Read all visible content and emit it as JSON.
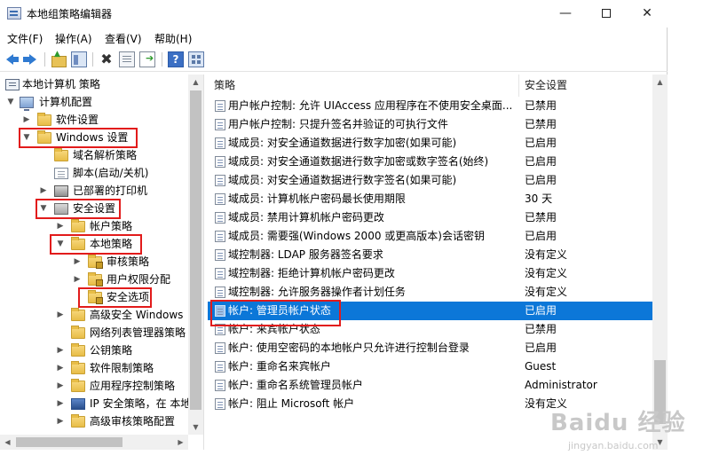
{
  "window": {
    "title": "本地组策略编辑器",
    "controls": {
      "minimize": "—",
      "maximize": "",
      "close": "✕"
    }
  },
  "menubar": [
    "文件(F)",
    "操作(A)",
    "查看(V)",
    "帮助(H)"
  ],
  "toolbar": {
    "icons": [
      "back-arrow-icon",
      "forward-arrow-icon",
      "up-folder-icon",
      "show-hide-tree-icon",
      "delete-icon",
      "properties-icon",
      "export-list-icon",
      "help-icon",
      "view-icon"
    ],
    "delete_glyph": "✖",
    "help_glyph": "?"
  },
  "tree": [
    {
      "label": "本地计算机 策略",
      "expander": "",
      "icon": "policy-icon",
      "highlight": false
    },
    {
      "label": "计算机配置",
      "expander": "▼",
      "icon": "computer-icon",
      "highlight": false
    },
    {
      "label": "软件设置",
      "expander": "▶",
      "icon": "folder-icon",
      "highlight": false
    },
    {
      "label": "Windows 设置",
      "expander": "▼",
      "icon": "folder-icon",
      "highlight": true
    },
    {
      "label": "域名解析策略",
      "expander": "",
      "icon": "folder-icon",
      "highlight": false
    },
    {
      "label": "脚本(启动/关机)",
      "expander": "",
      "icon": "script-icon",
      "highlight": false
    },
    {
      "label": "已部署的打印机",
      "expander": "▶",
      "icon": "printer-icon",
      "highlight": false
    },
    {
      "label": "安全设置",
      "expander": "▼",
      "icon": "security-settings-icon",
      "highlight": true
    },
    {
      "label": "帐户策略",
      "expander": "▶",
      "icon": "folder-icon",
      "highlight": false
    },
    {
      "label": "本地策略",
      "expander": "▼",
      "icon": "folder-icon",
      "highlight": true
    },
    {
      "label": "审核策略",
      "expander": "▶",
      "icon": "locked-folder-icon",
      "highlight": false
    },
    {
      "label": "用户权限分配",
      "expander": "▶",
      "icon": "locked-folder-icon",
      "highlight": false
    },
    {
      "label": "安全选项",
      "expander": "",
      "icon": "locked-folder-icon",
      "highlight": true
    },
    {
      "label": "高级安全 Windows",
      "expander": "▶",
      "icon": "folder-icon",
      "highlight": false
    },
    {
      "label": "网络列表管理器策略",
      "expander": "",
      "icon": "folder-icon",
      "highlight": false
    },
    {
      "label": "公钥策略",
      "expander": "▶",
      "icon": "folder-icon",
      "highlight": false
    },
    {
      "label": "软件限制策略",
      "expander": "▶",
      "icon": "folder-icon",
      "highlight": false
    },
    {
      "label": "应用程序控制策略",
      "expander": "▶",
      "icon": "folder-icon",
      "highlight": false
    },
    {
      "label": "IP 安全策略，在 本地",
      "expander": "▶",
      "icon": "ip-security-icon",
      "highlight": false
    },
    {
      "label": "高级审核策略配置",
      "expander": "▶",
      "icon": "folder-icon",
      "highlight": false
    }
  ],
  "list": {
    "columns": {
      "policy": "策略",
      "setting": "安全设置"
    },
    "rows": [
      {
        "name": "用户帐户控制: 允许 UIAccess 应用程序在不使用安全桌面...",
        "setting": "已禁用",
        "selected": false
      },
      {
        "name": "用户帐户控制: 只提升签名并验证的可执行文件",
        "setting": "已禁用",
        "selected": false
      },
      {
        "name": "域成员: 对安全通道数据进行数字加密(如果可能)",
        "setting": "已启用",
        "selected": false
      },
      {
        "name": "域成员: 对安全通道数据进行数字加密或数字签名(始终)",
        "setting": "已启用",
        "selected": false
      },
      {
        "name": "域成员: 对安全通道数据进行数字签名(如果可能)",
        "setting": "已启用",
        "selected": false
      },
      {
        "name": "域成员: 计算机帐户密码最长使用期限",
        "setting": "30 天",
        "selected": false
      },
      {
        "name": "域成员: 禁用计算机帐户密码更改",
        "setting": "已禁用",
        "selected": false
      },
      {
        "name": "域成员: 需要强(Windows 2000 或更高版本)会话密钥",
        "setting": "已启用",
        "selected": false
      },
      {
        "name": "域控制器: LDAP 服务器签名要求",
        "setting": "没有定义",
        "selected": false
      },
      {
        "name": "域控制器: 拒绝计算机帐户密码更改",
        "setting": "没有定义",
        "selected": false
      },
      {
        "name": "域控制器: 允许服务器操作者计划任务",
        "setting": "没有定义",
        "selected": false
      },
      {
        "name": "帐户: 管理员帐户状态",
        "setting": "已启用",
        "selected": true
      },
      {
        "name": "帐户: 来宾帐户状态",
        "setting": "已禁用",
        "selected": false
      },
      {
        "name": "帐户: 使用空密码的本地帐户只允许进行控制台登录",
        "setting": "已启用",
        "selected": false
      },
      {
        "name": "帐户: 重命名来宾帐户",
        "setting": "Guest",
        "selected": false
      },
      {
        "name": "帐户: 重命名系统管理员帐户",
        "setting": "Administrator",
        "selected": false
      },
      {
        "name": "帐户: 阻止 Microsoft 帐户",
        "setting": "没有定义",
        "selected": false
      }
    ]
  },
  "scroll": {
    "tree_vertical_position": 0.0,
    "list_vertical_position": 0.62
  },
  "watermark": {
    "main": "Baidu 经验",
    "sub": "jingyan.baidu.com"
  },
  "colors": {
    "selection": "#0c77d8",
    "highlight_box": "#e21b1b"
  }
}
